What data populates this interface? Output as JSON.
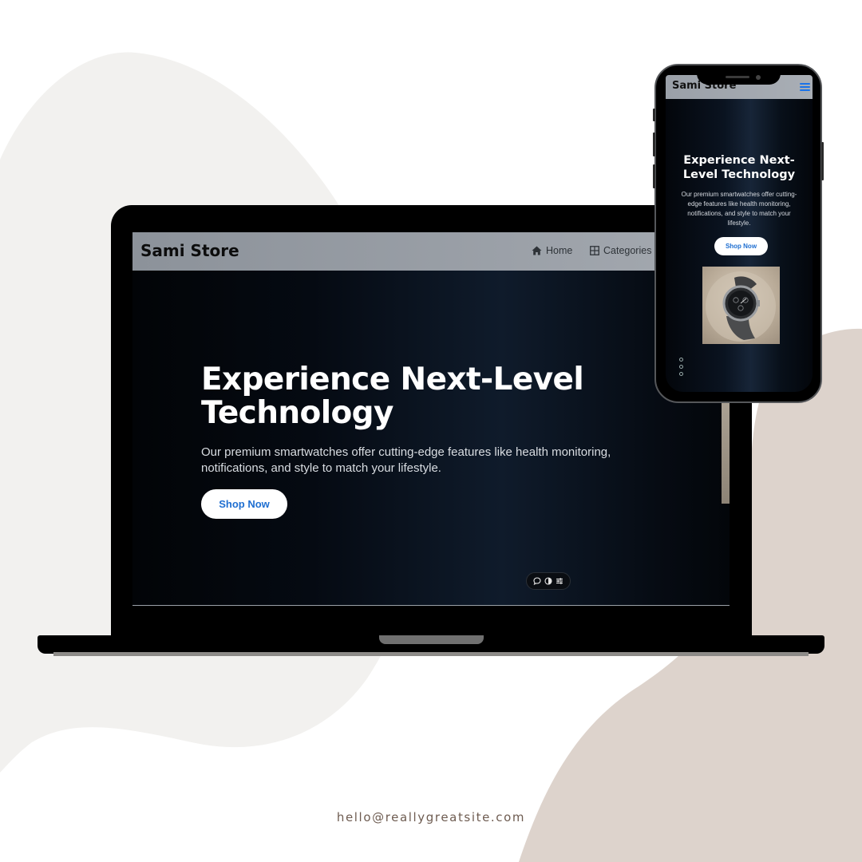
{
  "colors": {
    "background": "#ffffff",
    "blob_light": "#f2f1ef",
    "blob_taupe": "#ddd3cc",
    "nav_gray": "#a4a9b0",
    "hero_dark": "#050a12",
    "button_text_blue": "#1f6fd1",
    "footer_text": "#6e5c51"
  },
  "laptop": {
    "brand": "Sami Store",
    "nav": [
      {
        "label": "Home",
        "icon": "home-icon"
      },
      {
        "label": "Categories",
        "icon": "grid-icon"
      }
    ],
    "hero": {
      "title_line1": "Experience Next-Level",
      "title_line2": "Technology",
      "subtitle_line1": "Our premium smartwatches offer cutting-edge features like health monitoring,",
      "subtitle_line2": "notifications, and style to match your lifestyle.",
      "cta": "Shop Now"
    },
    "accessibility_tools": [
      "chat-bubble-icon",
      "contrast-icon",
      "settings-sliders-icon"
    ]
  },
  "phone": {
    "brand": "Sami Store",
    "menu_icon": "hamburger-menu-icon",
    "hero": {
      "title_line1": "Experience Next-",
      "title_line2": "Level Technology",
      "subtitle_line1": "Our premium smartwatches offer cutting-",
      "subtitle_line2": "edge features like health monitoring,",
      "subtitle_line3": "notifications, and style to match your",
      "subtitle_line4": "lifestyle.",
      "cta": "Shop Now"
    },
    "product_image": "smartwatch-product-image",
    "accessibility_tools": [
      "chat-bubble-icon",
      "contrast-icon",
      "settings-sliders-icon"
    ]
  },
  "footer": {
    "email": "hello@reallygreatsite.com"
  }
}
